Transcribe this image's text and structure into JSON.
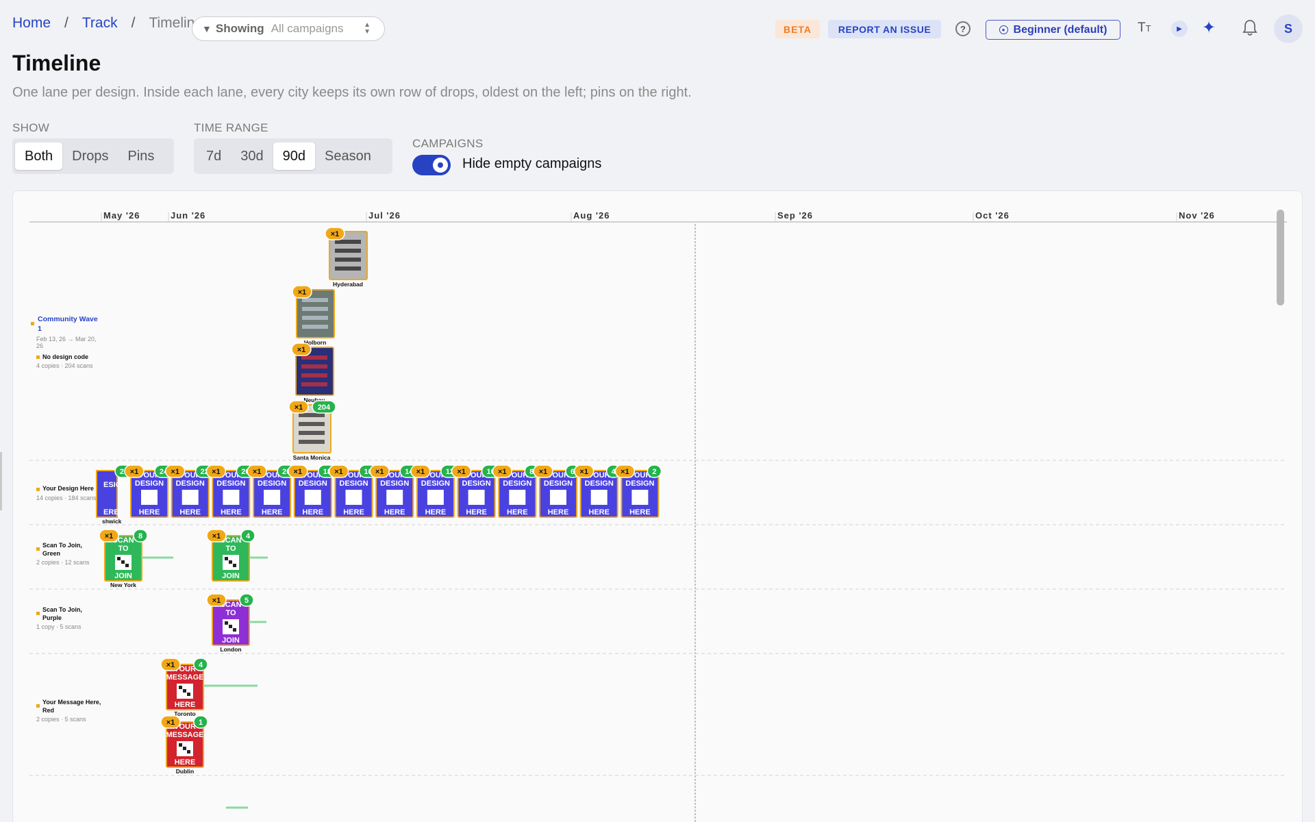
{
  "breadcrumb": {
    "home": "Home",
    "track": "Track",
    "current": "Timeline",
    "sep": "/"
  },
  "filter": {
    "label": "Showing",
    "value": "All campaigns"
  },
  "header": {
    "beta": "BETA",
    "report": "REPORT AN ISSUE",
    "help": "?",
    "level": "Beginner (default)",
    "avatar": "S"
  },
  "page": {
    "title": "Timeline",
    "subtitle": "One lane per design. Inside each lane, every city keeps its own row of drops, oldest on the left; pins on the right."
  },
  "controls": {
    "show_label": "SHOW",
    "show_options": [
      "Both",
      "Drops",
      "Pins"
    ],
    "show_selected": "Both",
    "range_label": "TIME RANGE",
    "range_options": [
      "7d",
      "30d",
      "90d",
      "Season"
    ],
    "range_selected": "90d",
    "campaigns_label": "CAMPAIGNS",
    "hide_empty_label": "Hide empty campaigns",
    "hide_empty_on": true
  },
  "timeline": {
    "months": [
      "May '26",
      "Jun '26",
      "Jul '26",
      "Aug '26",
      "Sep '26",
      "Oct '26",
      "Nov '26"
    ],
    "lanes": [
      {
        "title": "Community Wave 1",
        "dates": "Feb 13, 26 → Mar 20, 26",
        "design": "No design code",
        "stats": "4 copies · 204 scans",
        "accent": "#2743c4",
        "drops": [
          {
            "city": "Hyderabad",
            "copies": "×1",
            "scans": "",
            "style": "photo-sign"
          },
          {
            "city": "Holborn",
            "copies": "×1",
            "scans": "",
            "style": "photo-street"
          },
          {
            "city": "Neubau",
            "copies": "×1",
            "scans": "",
            "style": "photo-poster"
          },
          {
            "city": "Santa Monica",
            "copies": "×1",
            "scans": "204",
            "style": "photo-billboard"
          }
        ]
      },
      {
        "title": "Your Design Here",
        "stats": "14 copies · 184 scans",
        "poster": {
          "line1": "YOUR",
          "line2": "DESIGN",
          "line3": "HERE",
          "color": "#4a42e0"
        },
        "city_partial": "shwick",
        "copies": "×1",
        "scans": [
          "26",
          "24",
          "22",
          "20",
          "20",
          "18",
          "16",
          "14",
          "12",
          "10",
          "8",
          "6",
          "4",
          "2"
        ]
      },
      {
        "title": "Scan To Join, Green",
        "stats": "2 copies · 12 scans",
        "poster": {
          "line1": "SCAN",
          "line2": "TO",
          "line3": "JOIN",
          "color": "#2fb85a"
        },
        "drops": [
          {
            "city": "New York",
            "copies": "×1",
            "scans": "8"
          },
          {
            "city": "",
            "copies": "×1",
            "scans": "4"
          }
        ]
      },
      {
        "title": "Scan To Join, Purple",
        "stats": "1 copy · 5 scans",
        "poster": {
          "line1": "SCAN",
          "line2": "TO",
          "line3": "JOIN",
          "color": "#8e2fd6"
        },
        "drops": [
          {
            "city": "London",
            "copies": "×1",
            "scans": "5"
          }
        ]
      },
      {
        "title": "Your Message Here, Red",
        "stats": "2 copies · 5 scans",
        "poster": {
          "line1": "YOUR",
          "line2": "MESSAGE",
          "line3": "HERE",
          "color": "#d2232e"
        },
        "drops": [
          {
            "city": "Toronto",
            "copies": "×1",
            "scans": "4"
          },
          {
            "city": "Dublin",
            "copies": "×1",
            "scans": "1"
          }
        ]
      }
    ]
  },
  "colors": {
    "accent": "#2743c4",
    "badge_copies": "#f0a818",
    "badge_scans": "#26b24d",
    "lane_dot": "#f0a818"
  }
}
